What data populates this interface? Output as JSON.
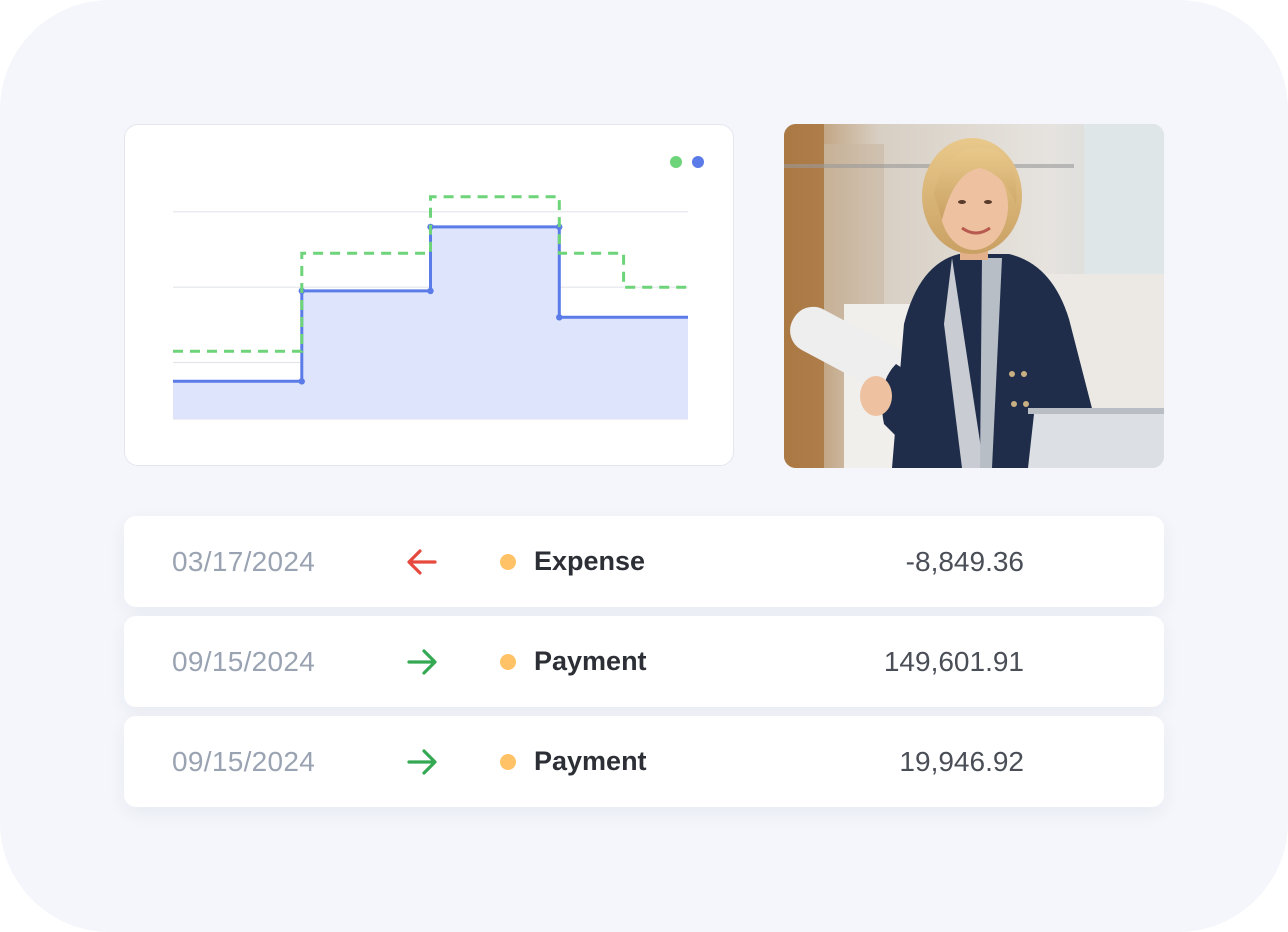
{
  "colors": {
    "series_a": "#5b7be8",
    "series_a_fill": "#dde4fc",
    "series_b": "#6dd479",
    "grid": "#e3e5ea",
    "expense_arrow": "#e64a3f",
    "payment_arrow": "#34a853",
    "status_dot": "#ffc266"
  },
  "chart_data": {
    "type": "line",
    "x": [
      0,
      1,
      2,
      3,
      4,
      5,
      6,
      7,
      8
    ],
    "series": [
      {
        "values": [
          1.0,
          1.0,
          3.4,
          3.4,
          5.1,
          5.1,
          2.7,
          2.7,
          2.7
        ],
        "style": "solid-step-area",
        "color": "#5b7be8"
      },
      {
        "values": [
          1.8,
          1.8,
          4.4,
          4.4,
          5.9,
          5.9,
          4.4,
          3.5,
          3.5
        ],
        "style": "dashed-step",
        "color": "#6dd479"
      }
    ],
    "ylim": [
      0,
      6
    ],
    "grid": true,
    "legend": "top-right"
  },
  "photo": {
    "icon": "photo-professional-woman"
  },
  "transactions": [
    {
      "date": "03/17/2024",
      "direction": "arrow-left-icon",
      "type": "Expense",
      "amount": "-8,849.36"
    },
    {
      "date": "09/15/2024",
      "direction": "arrow-right-icon",
      "type": "Payment",
      "amount": "149,601.91"
    },
    {
      "date": "09/15/2024",
      "direction": "arrow-right-icon",
      "type": "Payment",
      "amount": "19,946.92"
    }
  ]
}
